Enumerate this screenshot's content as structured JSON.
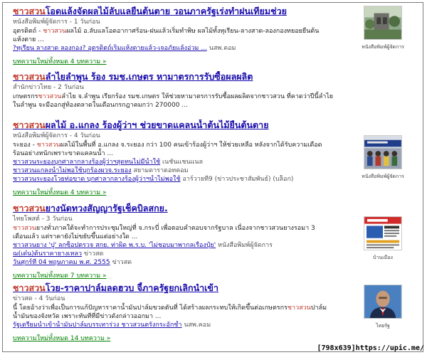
{
  "results": [
    {
      "title_pre": "ชาวสวน",
      "title_rest": "โอดแล้งจัดผลไม้ลับแลยืนต้นตาย วอนภาครัฐเร่งทำฝนเทียมช่วย",
      "meta": "หนังสือพิมพ์ผู้จัดการ - 1 วันก่อน",
      "snippet_1": "อุตรดิตถ์ - ",
      "snippet_hl": "ชาวสวน",
      "snippet_2": "ผลไม้ อ.ลับแลโอดอากาศร้อน-ฝนแล้วเริ่มทำพิษ ผลไม้ทั้งทุเรียน-ลางสาด-ลองกองทยอยยืนต้นแห้งตาย ...",
      "related": [
        {
          "text": "?ทุเรียน ลางสาด ลองกอง? อุตรดิตถ์เริ่มแห้งตายแล้ว-เจอภัยแล้งอ่วม ...",
          "source": "นสพ.คอม"
        }
      ],
      "more": "บทความใหม่ทั้งหมด 4 บทความ »",
      "thumb_caption": "หนังสือพิมพ์ผู้จัดการ"
    },
    {
      "title_pre": "ชาวสวน",
      "title_rest": "ลำไยลำพูน ร้อง รมช.เกษตร หามาตรการรับซื้อผลผลิต",
      "meta": "สำนักข่าวไทย - 2 วันก่อน",
      "snippet_1": "เกษตรกร",
      "snippet_hl": "ชาวสวน",
      "snippet_2": "ลำไย จ.ลำพูน เรียกร้อง รมช.เกษตร ให้ช่วยหามาตรการรับซื้อผลผลิตจากชาวสวน ที่คาดว่าปีนี้ลำไยในลำพูน จะมีออกสู่ท้องตลาดในเดือนกรกฎาคมกว่า 270000 ..."
    },
    {
      "title_pre": "ชาวสวน",
      "title_rest": "ผลไม้ อ.แกลง ร้องผู้ว่าฯ ช่วยขาดแคลนน้ำต้นไม้ยืนต้นตาย",
      "meta": "หนังสือพิมพ์ผู้จัดการ - 4 วันก่อน",
      "snippet_1": "ระยอง - ",
      "snippet_hl": "ชาวสวน",
      "snippet_2": "ผลไม้ในพื้นที่ อ.แกลง จ.ระยอง กว่า 100 คนเข้าร้องผู้ว่าฯ ให้ช่วยเหลือ หลังจากได้รับความเดือดร้อนอย่างหนักเพราะขาดแคลนน้ำ ...",
      "related": [
        {
          "text": "ชาวสวนระยองบุกศาลากลางร้องผู้ว่าฯสุดทนไม่มีน้ำใช้",
          "source": "เนชั่นแชนแนล"
        },
        {
          "text": "ชาวสวนแกลงน้ำไม่พอใช้บุกร้องผวจ.ระยอง",
          "source": "สยามดาราดอทคอม"
        },
        {
          "text": "ชาวสวนระยองโวยท่อขาด บุกศาลากลางร้องผู้ว่าฯน้ำไม่พอใช้",
          "source": "อาร์วายที9 (ข่าวประชาสัมพันธ์) (บล็อก)"
        }
      ],
      "more": "บทความใหม่ทั้งหมด 4 บทความ »",
      "thumb_caption": "หนังสือพิมพ์ผู้จัดการ"
    },
    {
      "title_pre": "ชาวสวน",
      "title_rest": "ยางนัดทวงสัญญารัฐเช็คบิลสกย.",
      "meta": "ไทยโพสต์ - 3 วันก่อน",
      "snippet_1": "",
      "snippet_hl": "ชาวสวน",
      "snippet_2": "ยางทั่วภาคใต้จะทำการประชุมใหญ่ที่ จ.กระบี่ เพื่อตอบคำตอบจากรัฐบาล เนื่องจากชาวสวนยางรอมา 3 เดือนแล้ว แต่ราคายังไม่ขยับขึ้นแต่อย่างใด ...",
      "related": [
        {
          "text": "ชาวสวนยาง 'ปู' ลกซ็อปตรวจ สกย. ท่าผิด พ.ร.บ. 'ไม่ชอบมาพากลเรื่องปุ๋ย'",
          "source": "หนังสือพิมพ์ผู้จัดการ"
        },
        {
          "text": "ฌ(เด๋น)ต้นราคายางเหลว",
          "source": "ข่าวสด"
        },
        {
          "text": "วันศุกร์ที่ 04 พฤษภาคม พ.ศ. 2555",
          "source": "ข่าวสด"
        }
      ],
      "more": "บทความใหม่ทั้งหมด 7 บทความ »",
      "thumb_caption": "บ้านเมือง"
    },
    {
      "title_pre": "ชาวสวน",
      "title_rest": "โวย-ราคาปาล์มลดฮวบ จี้ภาครัฐยกเลิกนำเข้า",
      "meta": "ข่าวสด - 4 วันก่อน",
      "snippet_1": "นี้ โดยอ้างว่าเพื่อเป็นการแก้ปัญหาราคาน้ำมันปาล์มขวดตันที่ ได้สร้างผลกระทบให้เกิดขึ้นต่อเกษตรกร",
      "snippet_hl": "ชาวสวน",
      "snippet_2": "ปาล์มน้ำมันของจังหวัด เพราะทันทีที่มีข่าวดังกล่าวออกมา ...",
      "related": [
        {
          "text": "รัฐเตรียมนำเข้าน้ำมันปาล์มบรรเทาร่วง ชาวสวนตรังกระอักช้ำ",
          "source": "นสพ.คอม"
        }
      ],
      "more": "บทความใหม่ทั้งหมด 14 บทความ »",
      "thumb_caption": "ไทยรัฐ"
    }
  ],
  "watermark": "[798x639]https://upic.me/"
}
